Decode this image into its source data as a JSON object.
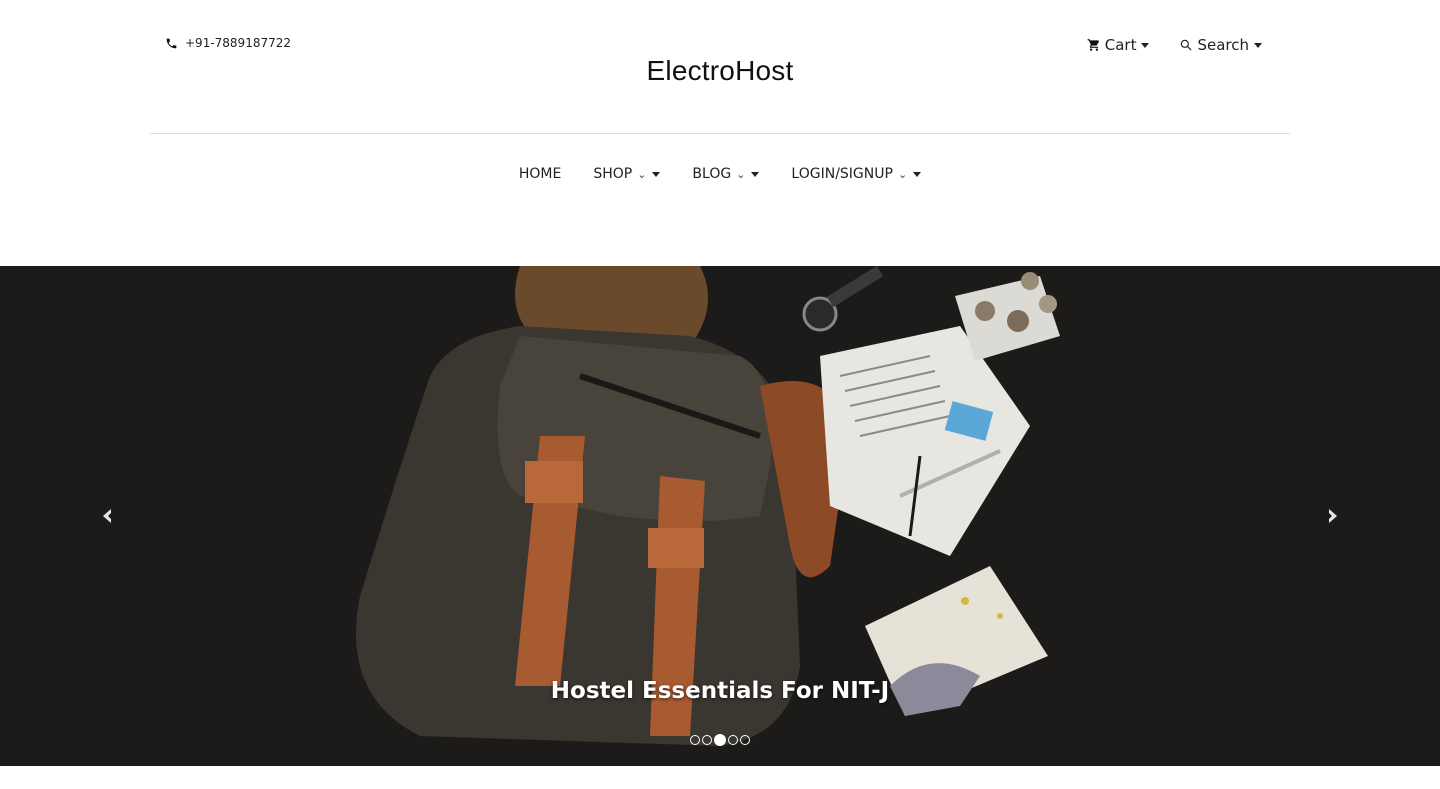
{
  "header": {
    "phone": "+91-7889187722",
    "brand": "ElectroHost",
    "cart_label": "Cart",
    "search_label": "Search"
  },
  "nav": {
    "items": [
      {
        "label": "HOME",
        "dropdown": false
      },
      {
        "label": "SHOP",
        "dropdown": true
      },
      {
        "label": "BLOG",
        "dropdown": true
      },
      {
        "label": "LOGIN/SIGNUP",
        "dropdown": true
      }
    ]
  },
  "carousel": {
    "caption": "Hostel Essentials For NIT-J",
    "slide_count": 5,
    "active_index": 2,
    "prev_icon": "chevron-left-icon",
    "next_icon": "chevron-right-icon"
  },
  "colors": {
    "hero_bg": "#1c1b1a",
    "text": "#222222",
    "divider": "#dcdcdc"
  }
}
